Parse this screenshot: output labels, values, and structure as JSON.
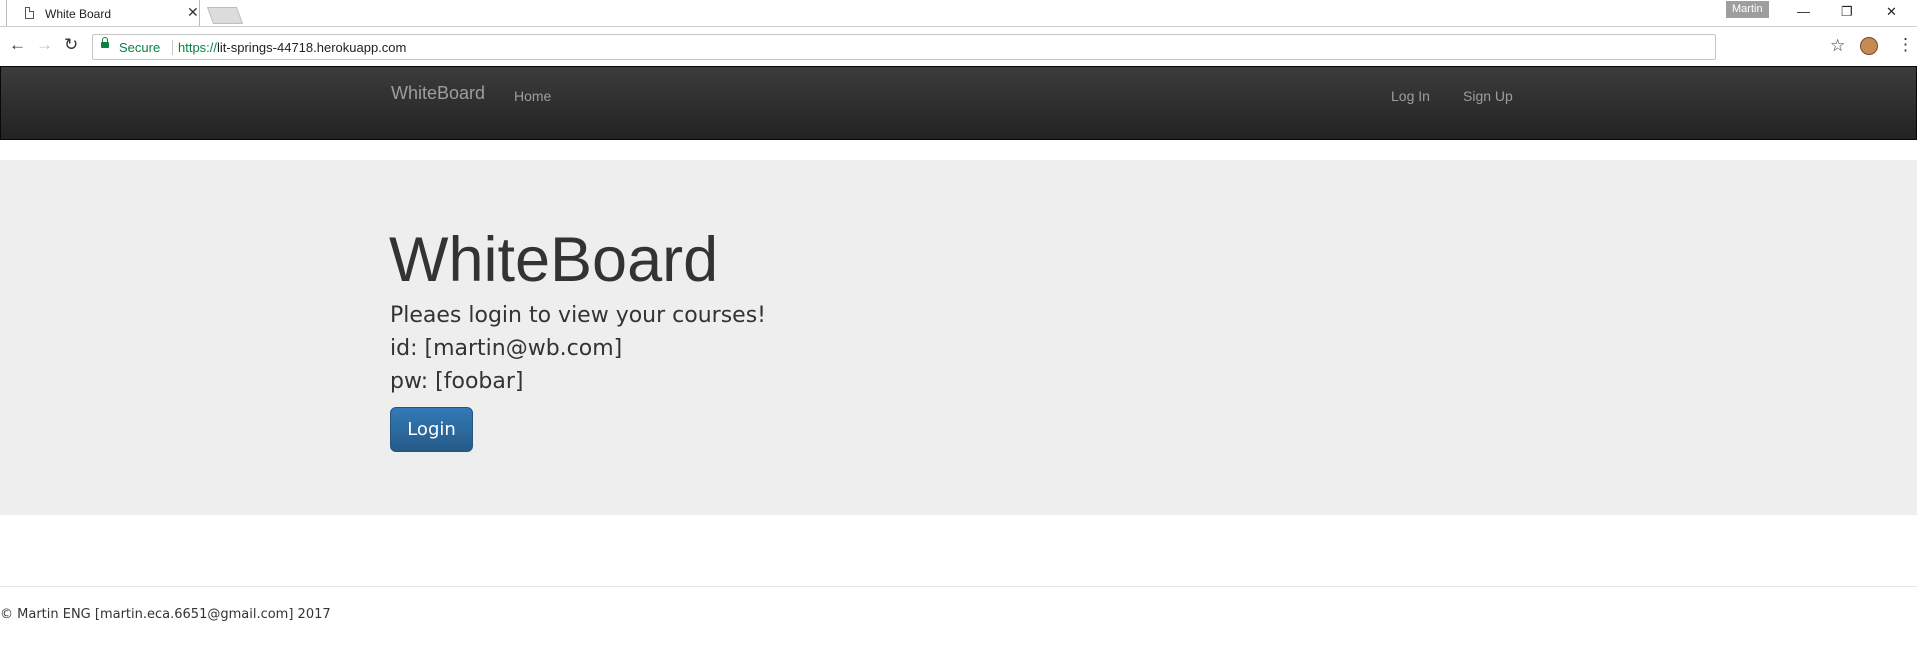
{
  "browser": {
    "tab_title": "White Board",
    "tab_close": "✕",
    "profile_name": "Martin",
    "window_controls": {
      "minimize": "—",
      "restore": "❐",
      "close": "✕"
    },
    "back_glyph": "←",
    "forward_glyph": "→",
    "reload_glyph": "↻",
    "security_label": "Secure",
    "url_scheme": "https://",
    "url_host": "lit-springs-44718.herokuapp.com",
    "bookmark_glyph": "☆",
    "menu_glyph": "⋮"
  },
  "navbar": {
    "brand": "WhiteBoard",
    "links": {
      "home": "Home",
      "login": "Log In",
      "signup": "Sign Up"
    }
  },
  "jumbotron": {
    "title": "WhiteBoard",
    "message": "Pleaes login to view your courses!",
    "id_line": "id: [martin@wb.com]",
    "pw_line": "pw: [foobar]",
    "login_button": "Login"
  },
  "footer": {
    "text": "© Martin ENG [martin.eca.6651@gmail.com] 2017"
  },
  "colors": {
    "navbar_bg": "#222222",
    "navbar_text": "#9d9d9d",
    "jumbotron_bg": "#eeeeee",
    "primary_button": "#337ab7",
    "secure_green": "#0b8043"
  }
}
